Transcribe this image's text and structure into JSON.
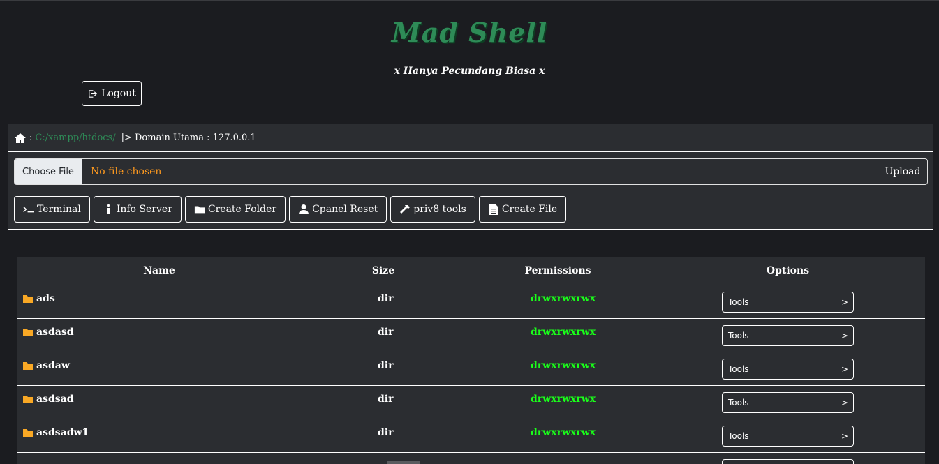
{
  "header": {
    "title": "Mad Shell",
    "subtitle": "x Hanya Pecundang Biasa x",
    "logout_label": "Logout"
  },
  "pathbar": {
    "separator": ":",
    "path": "C:/xampp/htdocs/",
    "domain": "|> Domain Utama : 127.0.0.1"
  },
  "upload": {
    "choose_label": "Choose File",
    "status": "No file chosen",
    "upload_label": "Upload"
  },
  "toolbar": {
    "terminal": "Terminal",
    "info_server": "Info Server",
    "create_folder": "Create Folder",
    "cpanel_reset": "Cpanel Reset",
    "priv8_tools": "priv8 tools",
    "create_file": "Create File"
  },
  "table": {
    "headers": {
      "name": "Name",
      "size": "Size",
      "permissions": "Permissions",
      "options": "Options"
    },
    "rows": [
      {
        "name": "ads",
        "size": "dir",
        "perm": "drwxrwxrwx",
        "tools": "Tools",
        "go": ">"
      },
      {
        "name": "asdasd",
        "size": "dir",
        "perm": "drwxrwxrwx",
        "tools": "Tools",
        "go": ">"
      },
      {
        "name": "asdaw",
        "size": "dir",
        "perm": "drwxrwxrwx",
        "tools": "Tools",
        "go": ">"
      },
      {
        "name": "asdsad",
        "size": "dir",
        "perm": "drwxrwxrwx",
        "tools": "Tools",
        "go": ">"
      },
      {
        "name": "asdsadw1",
        "size": "dir",
        "perm": "drwxrwxrwx",
        "tools": "Tools",
        "go": ">"
      },
      {
        "name": "",
        "size": "",
        "perm": "",
        "tools": "",
        "go": ""
      }
    ]
  },
  "colors": {
    "background": "#1b1c20",
    "panel": "#2b2d31",
    "accent_green": "#2e8b57",
    "permission_green": "#1aff1a",
    "file_status_orange": "#ff9a1f",
    "folder_yellow": "#f9a825"
  }
}
